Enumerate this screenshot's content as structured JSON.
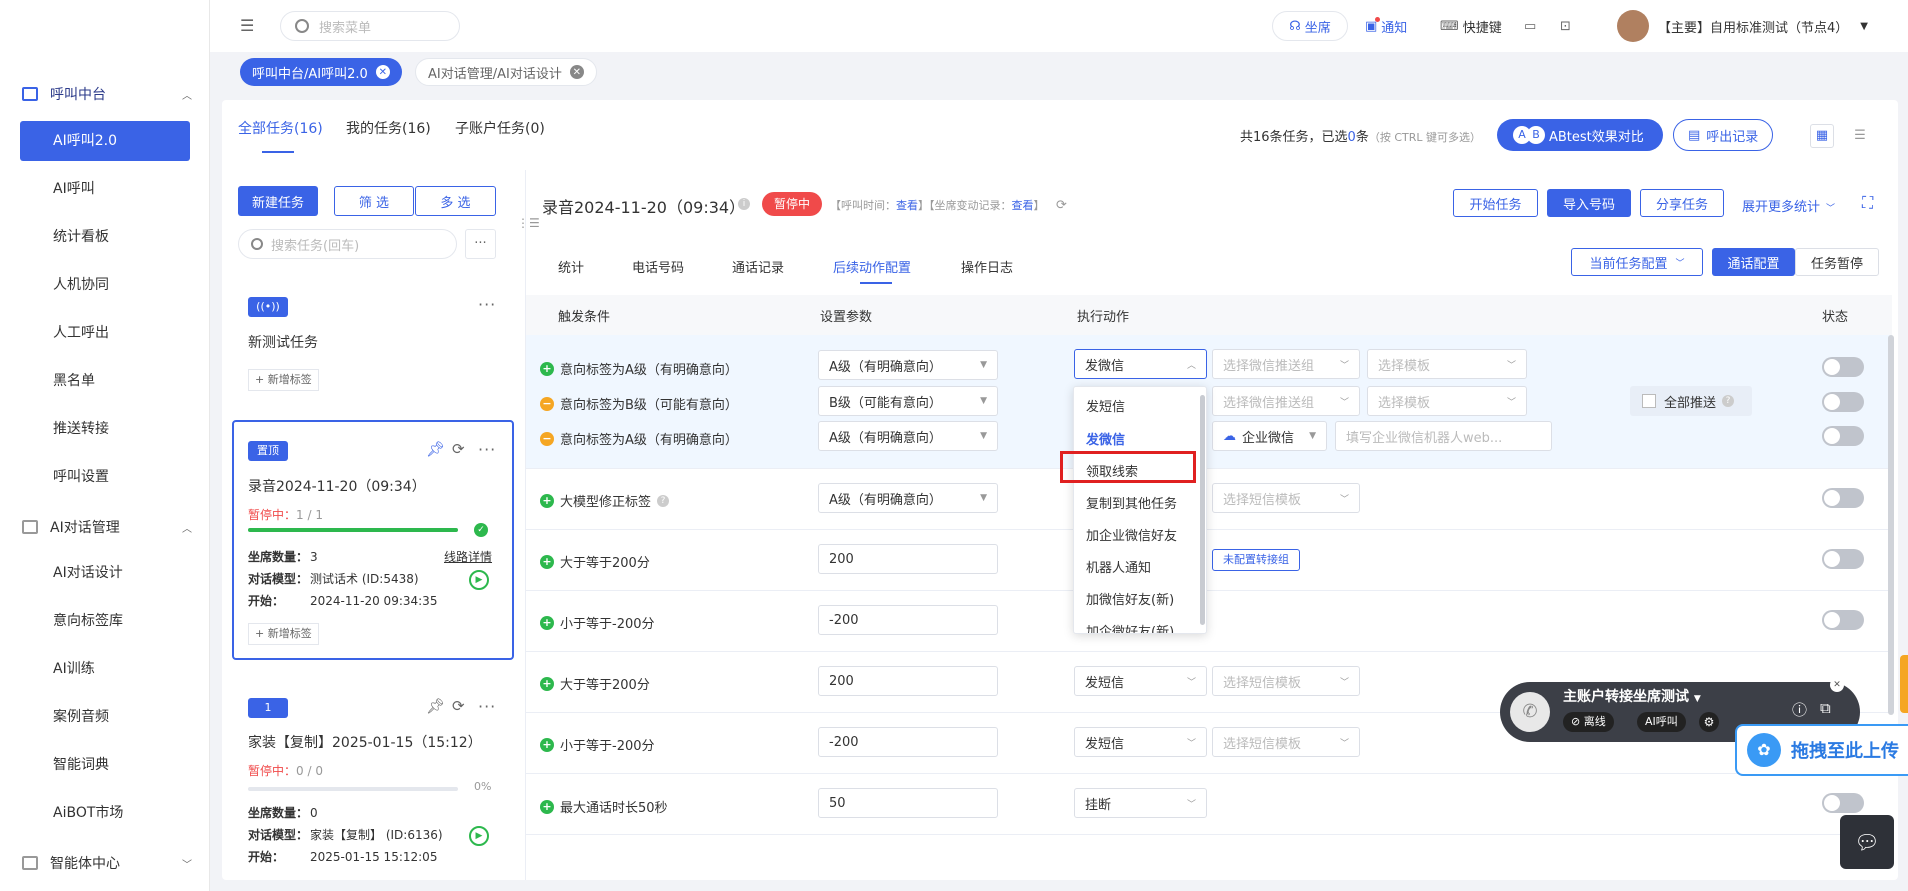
{
  "sidebar": {
    "groups": [
      {
        "label": "呼叫中台",
        "items": [
          "AI呼叫2.0",
          "AI呼叫",
          "统计看板",
          "人机协同",
          "人工呼出",
          "黑名单",
          "推送转接",
          "呼叫设置"
        ]
      },
      {
        "label": "AI对话管理",
        "items": [
          "AI对话设计",
          "意向标签库",
          "AI训练",
          "案例音频",
          "智能词典",
          "AiBOT市场"
        ]
      },
      {
        "label": "智能体中心",
        "items": []
      }
    ]
  },
  "header": {
    "search_placeholder": "搜索菜单",
    "seat": "坐席",
    "notify": "通知",
    "shortcut": "快捷键",
    "account": "【主要】自用标准测试（节点4）"
  },
  "tags": [
    {
      "label": "呼叫中台/AI呼叫2.0",
      "active": true
    },
    {
      "label": "AI对话管理/AI对话设计",
      "active": false
    }
  ],
  "task_tabs": [
    "全部任务(16)",
    "我的任务(16)",
    "子账户任务(0)"
  ],
  "summary": {
    "text_a": "共16条任务，已选",
    "selected": "0",
    "text_b": "条",
    "hint": "（按 CTRL 键可多选）",
    "ab_label": "ABtest效果对比",
    "ab_a": "A",
    "ab_b": "B",
    "outbound_label": "呼出记录"
  },
  "list_toolbar": {
    "new_task": "新建任务",
    "filter": "筛 选",
    "multi": "多 选",
    "search_placeholder": "搜索任务(回车)",
    "more": "···"
  },
  "tasks": [
    {
      "badge": "",
      "name": "新测试任务",
      "add_tag": "+ 新增标签"
    },
    {
      "badge": "置顶",
      "name": "录音2024-11-20（09:34）",
      "status_label": "暂停中：",
      "status_count": "1 / 1",
      "seat_label": "坐席数量：",
      "seat_count": "3",
      "route_detail": "线路详情",
      "model_label": "对话模型：",
      "model": "测试话术 (ID:5438)",
      "start_label": "开始：",
      "start": "2024-11-20 09:34:35",
      "add_tag": "+ 新增标签",
      "progress": 1
    },
    {
      "badge": "1",
      "name": "家装【复制】2025-01-15（15:12）",
      "status_label": "暂停中：",
      "status_count": "0 / 0",
      "percent": "0%",
      "seat_label": "坐席数量：",
      "seat_count": "0",
      "model_label": "对话模型：",
      "model": "家装【复制】 (ID:6136)",
      "start_label": "开始：",
      "start": "2025-01-15 15:12:05",
      "progress": 0
    }
  ],
  "detail": {
    "title": "录音2024-11-20（09:34）",
    "status": "暂停中",
    "meta_a": "【呼叫时间：",
    "meta_link1": "查看",
    "meta_b": "】【坐席变动记录：",
    "meta_link2": "查看",
    "meta_c": "】",
    "btn_start": "开始任务",
    "btn_import": "导入号码",
    "btn_share": "分享任务",
    "more_stats": "展开更多统计",
    "subtabs": [
      "统计",
      "电话号码",
      "通话记录",
      "后续动作配置",
      "操作日志"
    ],
    "current_config": "当前任务配置",
    "call_config": "通话配置",
    "task_pause": "任务暂停"
  },
  "table": {
    "headers": [
      "触发条件",
      "设置参数",
      "执行动作",
      "状态"
    ],
    "rows": [
      {
        "icon": "plus",
        "cond": "意向标签为A级（有明确意向）",
        "param": "A级（有明确意向）",
        "action": "发微信",
        "extra1": "选择微信推送组",
        "extra2": "选择模板"
      },
      {
        "icon": "minus",
        "cond": "意向标签为B级（可能有意向）",
        "param": "B级（可能有意向）",
        "action": "",
        "extra1": "选择微信推送组",
        "extra2": "选择模板"
      },
      {
        "icon": "minus",
        "cond": "意向标签为A级（有明确意向）",
        "param": "A级（有明确意向）",
        "action": "",
        "extra1": "企业微信",
        "extra2": "填写企业微信机器人web..."
      },
      {
        "icon": "plus",
        "cond": "大模型修正标签",
        "param": "A级（有明确意向）",
        "action": "",
        "extra1": "选择短信模板"
      },
      {
        "icon": "plus",
        "cond": "大于等于200分",
        "param": "200",
        "action": "",
        "extra1": "未配置转接组"
      },
      {
        "icon": "plus",
        "cond": "小于等于-200分",
        "param": "-200",
        "action": ""
      },
      {
        "icon": "plus",
        "cond": "大于等于200分",
        "param": "200",
        "action": "发短信",
        "extra1": "选择短信模板"
      },
      {
        "icon": "plus",
        "cond": "小于等于-200分",
        "param": "-200",
        "action": "发短信",
        "extra1": "选择短信模板"
      },
      {
        "icon": "plus",
        "cond": "最大通话时长50秒",
        "param": "50",
        "action": "挂断"
      }
    ],
    "push_all": "全部推送"
  },
  "dropdown": {
    "items": [
      "发短信",
      "发微信",
      "领取线索",
      "复制到其他任务",
      "加企业微信好友",
      "机器人通知",
      "加微信好友(新)",
      "加企微好友(新)"
    ],
    "selected": "发微信",
    "highlighted": "领取线索"
  },
  "float_widget": {
    "title": "主账户转接坐席测试",
    "offline": "离线",
    "ai_call": "AI呼叫"
  },
  "upload": {
    "label": "拖拽至此上传"
  },
  "colors": {
    "primary": "#3a63e6",
    "danger": "#f04a4a",
    "success": "#2db84d",
    "warning": "#f5a623"
  }
}
